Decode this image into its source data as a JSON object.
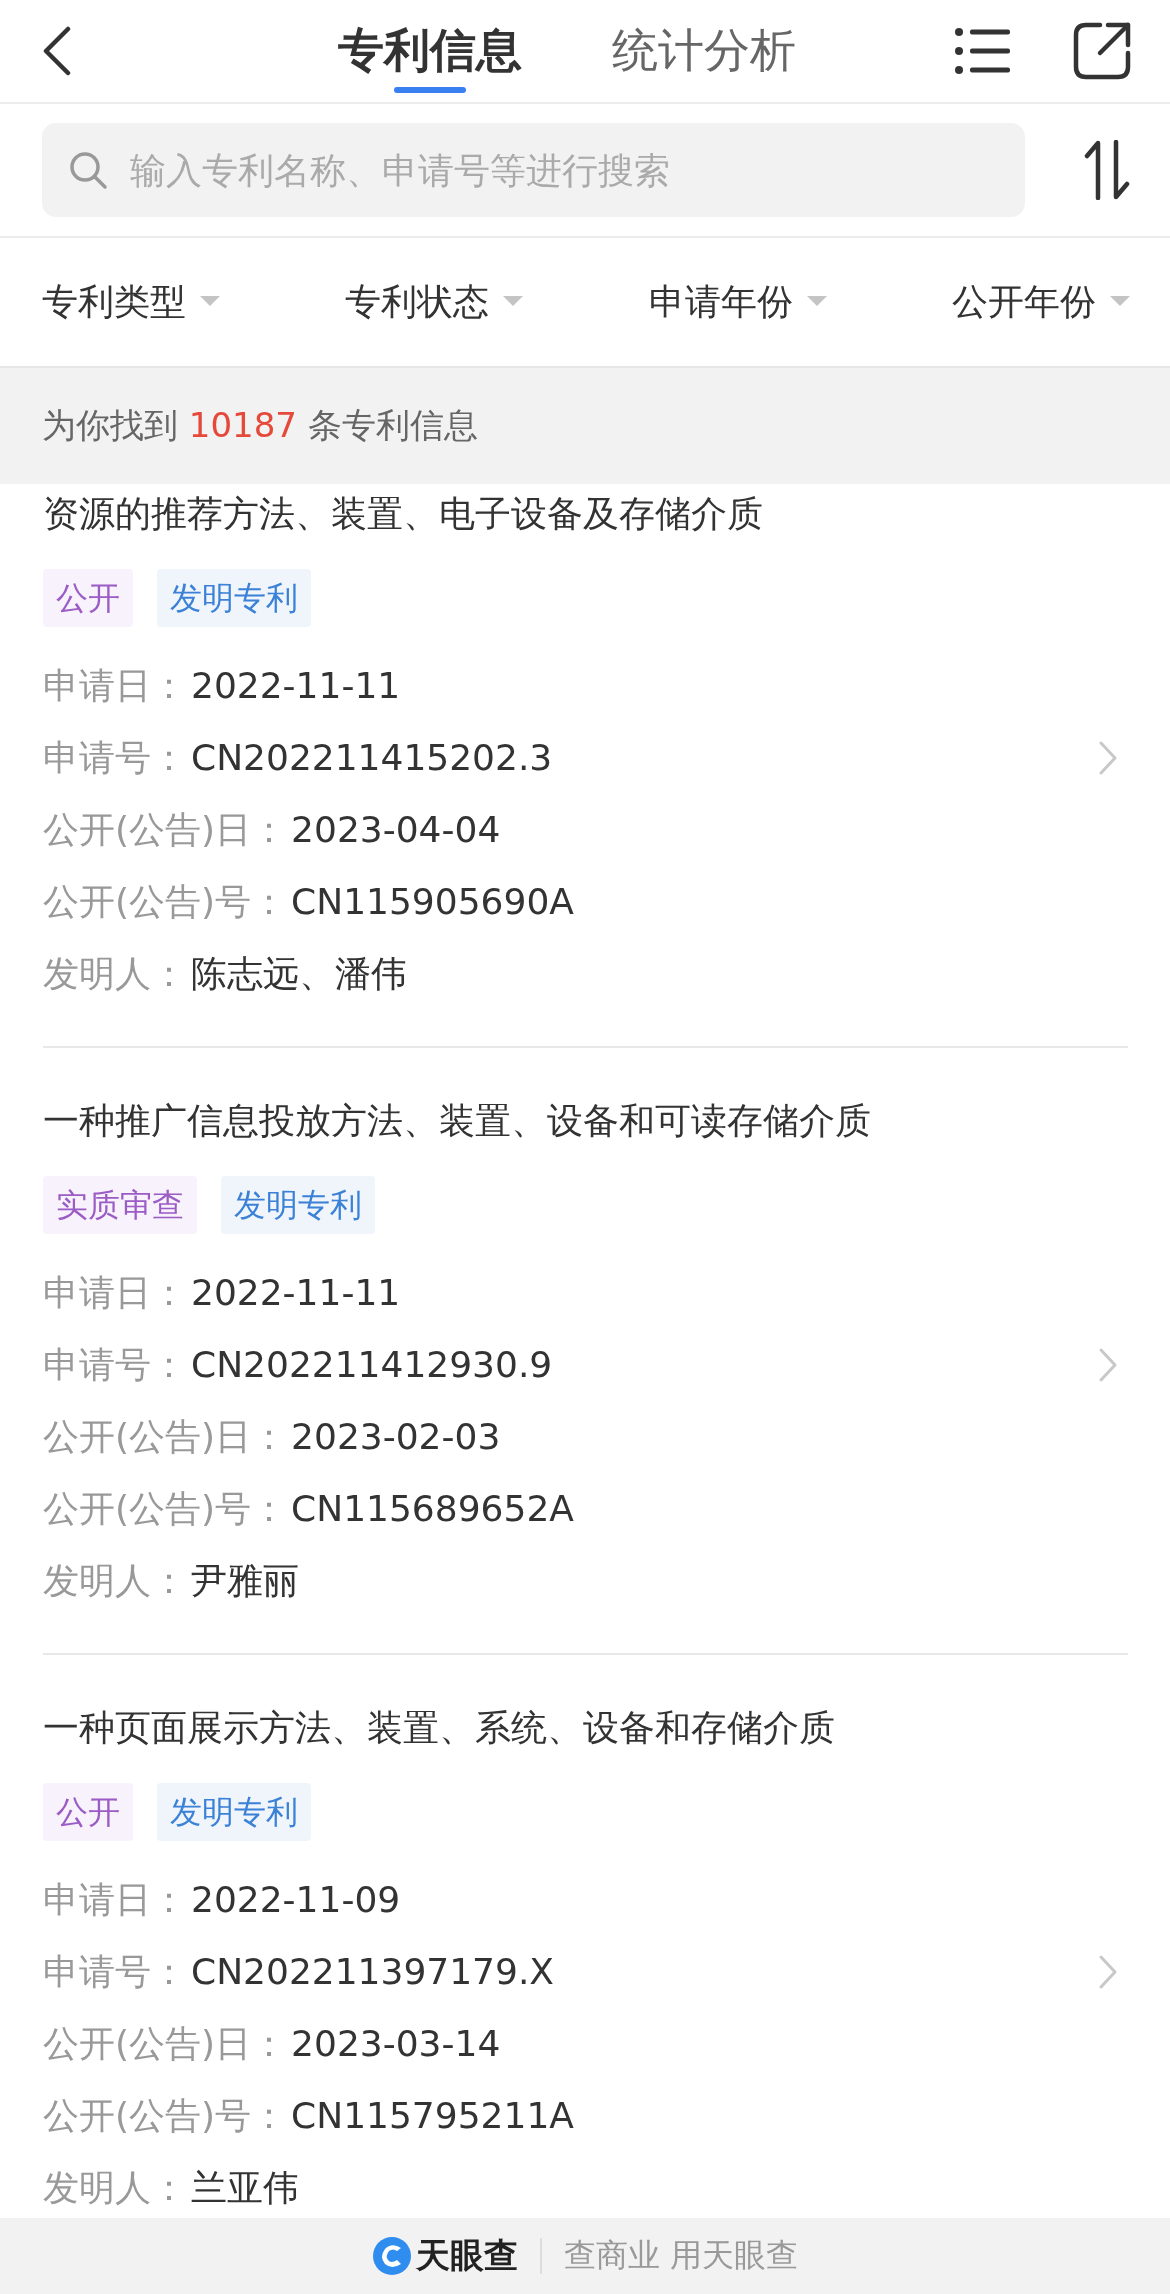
{
  "header": {
    "tabs": [
      {
        "label": "专利信息",
        "selected": true
      },
      {
        "label": "统计分析",
        "selected": false
      }
    ]
  },
  "search": {
    "placeholder": "输入专利名称、申请号等进行搜索"
  },
  "filters": [
    {
      "label": "专利类型"
    },
    {
      "label": "专利状态"
    },
    {
      "label": "申请年份"
    },
    {
      "label": "公开年份"
    }
  ],
  "result_count": {
    "prefix": "为你找到",
    "count": "10187",
    "suffix": "条专利信息"
  },
  "patents": [
    {
      "title": "资源的推荐方法、装置、电子设备及存储介质",
      "tags": [
        {
          "label": "公开",
          "color": "#9b5cc6"
        },
        {
          "label": "发明专利",
          "color": "#3b82d6"
        }
      ],
      "fields": [
        {
          "label": "申请日：",
          "value": "2022-11-11"
        },
        {
          "label": "申请号：",
          "value": "CN202211415202.3"
        },
        {
          "label": "公开(公告)日：",
          "value": "2023-04-04"
        },
        {
          "label": "公开(公告)号：",
          "value": "CN115905690A"
        },
        {
          "label": "发明人：",
          "value": "陈志远、潘伟"
        }
      ]
    },
    {
      "title": "一种推广信息投放方法、装置、设备和可读存储介质",
      "tags": [
        {
          "label": "实质审查",
          "color": "#9b5cc6"
        },
        {
          "label": "发明专利",
          "color": "#3b82d6"
        }
      ],
      "fields": [
        {
          "label": "申请日：",
          "value": "2022-11-11"
        },
        {
          "label": "申请号：",
          "value": "CN202211412930.9"
        },
        {
          "label": "公开(公告)日：",
          "value": "2023-02-03"
        },
        {
          "label": "公开(公告)号：",
          "value": "CN115689652A"
        },
        {
          "label": "发明人：",
          "value": "尹雅丽"
        }
      ]
    },
    {
      "title": "一种页面展示方法、装置、系统、设备和存储介质",
      "tags": [
        {
          "label": "公开",
          "color": "#9b5cc6"
        },
        {
          "label": "发明专利",
          "color": "#3b82d6"
        }
      ],
      "fields": [
        {
          "label": "申请日：",
          "value": "2022-11-09"
        },
        {
          "label": "申请号：",
          "value": "CN202211397179.X"
        },
        {
          "label": "公开(公告)日：",
          "value": "2023-03-14"
        },
        {
          "label": "公开(公告)号：",
          "value": "CN115795211A"
        },
        {
          "label": "发明人：",
          "value": "兰亚伟"
        }
      ]
    }
  ],
  "footer": {
    "brand": "天眼查",
    "slogan": "查商业 用天眼查"
  }
}
